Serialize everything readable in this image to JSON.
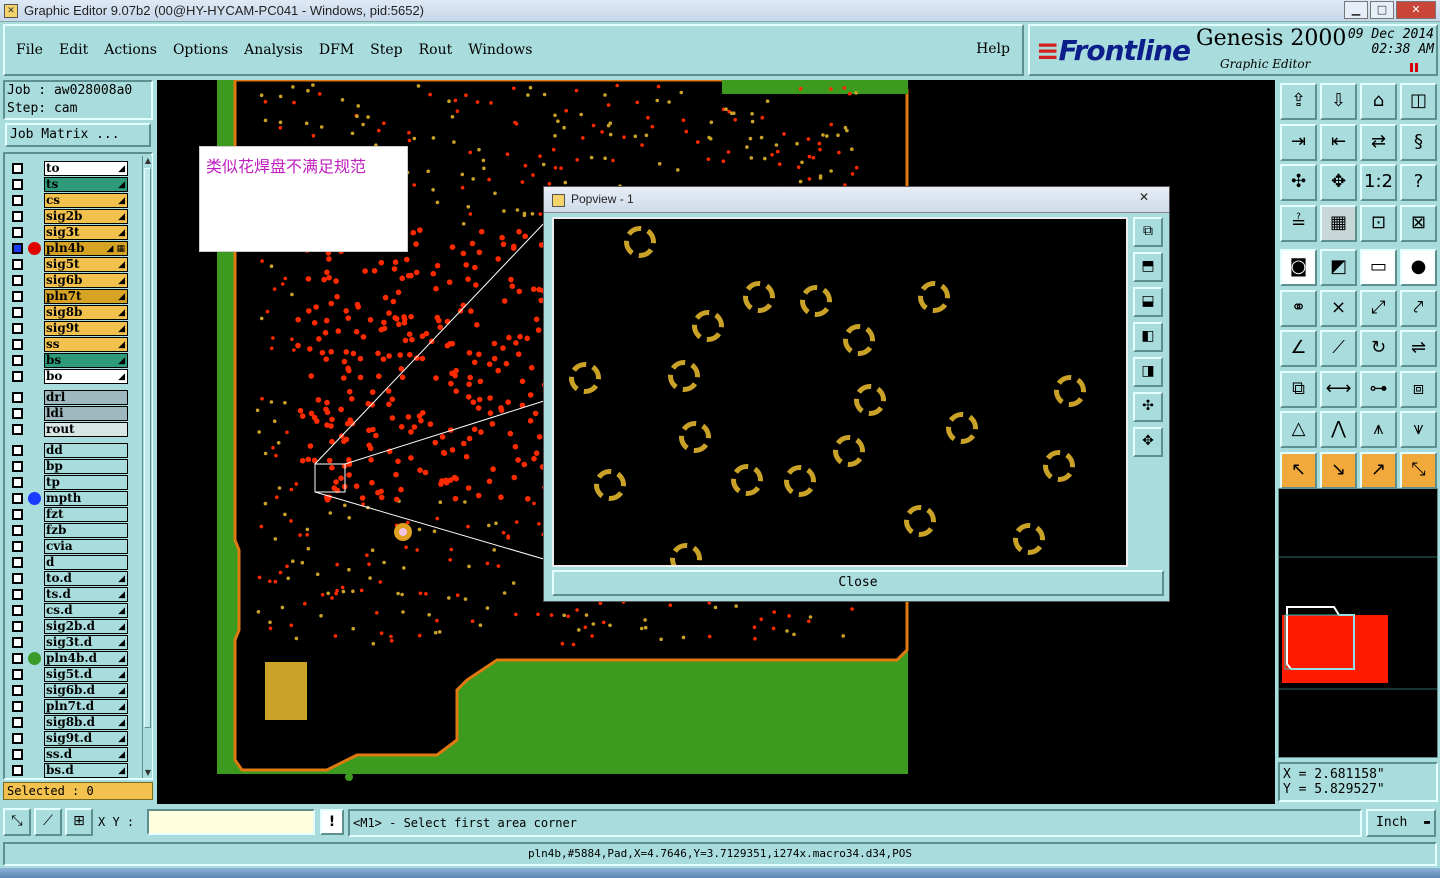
{
  "window": {
    "title": "Graphic Editor 9.07b2 (00@HY-HYCAM-PC041 - Windows, pid:5652)",
    "minimize": "▁",
    "maximize": "□",
    "close": "✕"
  },
  "menu": {
    "items": [
      "File",
      "Edit",
      "Actions",
      "Options",
      "Analysis",
      "DFM",
      "Step",
      "Rout",
      "Windows"
    ],
    "help": "Help"
  },
  "brand": {
    "logo": "Frontline",
    "product": "Genesis 2000",
    "subtitle": "Graphic Editor",
    "date": "09 Dec 2014",
    "time": "02:38 AM"
  },
  "job": {
    "job_line": "Job : aw028008a0",
    "step_line": "Step: cam",
    "matrix_button": "Job Matrix ..."
  },
  "layers": [
    {
      "name": "to",
      "color": "#ffffff",
      "mark": "◢",
      "dot": ""
    },
    {
      "name": "ts",
      "color": "#2e9a7a",
      "mark": "◢",
      "dot": ""
    },
    {
      "name": "cs",
      "color": "#f2c14e",
      "mark": "◢",
      "dot": ""
    },
    {
      "name": "sig2b",
      "color": "#f2c14e",
      "mark": "◢",
      "dot": ""
    },
    {
      "name": "sig3t",
      "color": "#f2c14e",
      "mark": "◢",
      "dot": ""
    },
    {
      "name": "pln4b",
      "color": "#d6a325",
      "mark": "◢ ▦",
      "dot": "#e00000",
      "work": true
    },
    {
      "name": "sig5t",
      "color": "#f2c14e",
      "mark": "◢",
      "dot": ""
    },
    {
      "name": "sig6b",
      "color": "#f2c14e",
      "mark": "◢",
      "dot": ""
    },
    {
      "name": "pln7t",
      "color": "#d6a325",
      "mark": "◢",
      "dot": ""
    },
    {
      "name": "sig8b",
      "color": "#f2c14e",
      "mark": "◢",
      "dot": ""
    },
    {
      "name": "sig9t",
      "color": "#f2c14e",
      "mark": "◢",
      "dot": ""
    },
    {
      "name": "ss",
      "color": "#f2c14e",
      "mark": "◢",
      "dot": ""
    },
    {
      "name": "bs",
      "color": "#2e9a7a",
      "mark": "◢",
      "dot": ""
    },
    {
      "name": "bo",
      "color": "#ffffff",
      "mark": "◢",
      "dot": ""
    },
    {
      "name": "drl",
      "color": "#9fb8c0",
      "mark": "",
      "dot": ""
    },
    {
      "name": "ldi",
      "color": "#9fb8c0",
      "mark": "",
      "dot": ""
    },
    {
      "name": "rout",
      "color": "#d9e6e6",
      "mark": "",
      "dot": ""
    },
    {
      "name": "dd",
      "color": "#a9dcdc",
      "mark": "",
      "dot": ""
    },
    {
      "name": "bp",
      "color": "#a9dcdc",
      "mark": "",
      "dot": ""
    },
    {
      "name": "tp",
      "color": "#a9dcdc",
      "mark": "",
      "dot": ""
    },
    {
      "name": "mpth",
      "color": "#a9dcdc",
      "mark": "",
      "dot": "#1a3cff"
    },
    {
      "name": "fzt",
      "color": "#a9dcdc",
      "mark": "",
      "dot": ""
    },
    {
      "name": "fzb",
      "color": "#a9dcdc",
      "mark": "",
      "dot": ""
    },
    {
      "name": "cvia",
      "color": "#a9dcdc",
      "mark": "",
      "dot": ""
    },
    {
      "name": "d",
      "color": "#a9dcdc",
      "mark": "",
      "dot": ""
    },
    {
      "name": "to.d",
      "color": "#a9dcdc",
      "mark": "◢",
      "dot": ""
    },
    {
      "name": "ts.d",
      "color": "#a9dcdc",
      "mark": "◢",
      "dot": ""
    },
    {
      "name": "cs.d",
      "color": "#a9dcdc",
      "mark": "◢",
      "dot": ""
    },
    {
      "name": "sig2b.d",
      "color": "#a9dcdc",
      "mark": "◢",
      "dot": ""
    },
    {
      "name": "sig3t.d",
      "color": "#a9dcdc",
      "mark": "◢",
      "dot": ""
    },
    {
      "name": "pln4b.d",
      "color": "#a9dcdc",
      "mark": "◢",
      "dot": "#3a9a2a"
    },
    {
      "name": "sig5t.d",
      "color": "#a9dcdc",
      "mark": "◢",
      "dot": ""
    },
    {
      "name": "sig6b.d",
      "color": "#a9dcdc",
      "mark": "◢",
      "dot": ""
    },
    {
      "name": "pln7t.d",
      "color": "#a9dcdc",
      "mark": "◢",
      "dot": ""
    },
    {
      "name": "sig8b.d",
      "color": "#a9dcdc",
      "mark": "◢",
      "dot": ""
    },
    {
      "name": "sig9t.d",
      "color": "#a9dcdc",
      "mark": "◢",
      "dot": ""
    },
    {
      "name": "ss.d",
      "color": "#a9dcdc",
      "mark": "◢",
      "dot": ""
    },
    {
      "name": "bs.d",
      "color": "#a9dcdc",
      "mark": "◢",
      "dot": ""
    }
  ],
  "selected": "Selected : 0",
  "annotation": "类似花焊盘不满足规范",
  "popview": {
    "title": "Popview - 1",
    "close_x": "✕",
    "close_button": "Close"
  },
  "coords": {
    "x": "X = 2.681158\"",
    "y": "Y = 5.829527\""
  },
  "bottom": {
    "xy_label": "X Y :",
    "xy_value": "",
    "prompt": "<M1> - Select first area corner",
    "units": "Inch"
  },
  "status": "pln4b,#5884,Pad,X=4.7646,Y=3.7129351,i274x.macro34.d34,POS",
  "colors": {
    "panel": "#a9dcdc",
    "board_green": "#3c9a1e",
    "pad_red": "#ff2a00",
    "pad_gold": "#c9a227",
    "accent_red": "#e00000"
  }
}
